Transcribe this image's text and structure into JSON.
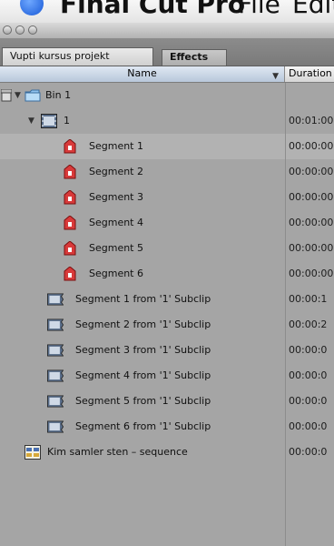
{
  "menubar": {
    "app_name": "Final Cut Pro",
    "menu_file": "File",
    "menu_edit": "Edit"
  },
  "tabs": [
    {
      "label": "Vupti kursus projekt",
      "active": true
    },
    {
      "label": "Effects",
      "active": false
    }
  ],
  "columns": {
    "name": "Name",
    "duration": "Duration"
  },
  "rows": [
    {
      "label": "Bin 1",
      "icon": "folder-icon",
      "duration": ""
    },
    {
      "label": "1",
      "icon": "clip-icon",
      "duration": "00:01:00"
    },
    {
      "label": "Segment 1",
      "icon": "marker-icon",
      "duration": "00:00:00",
      "selected": true
    },
    {
      "label": "Segment 2",
      "icon": "marker-icon",
      "duration": "00:00:00"
    },
    {
      "label": "Segment 3",
      "icon": "marker-icon",
      "duration": "00:00:00"
    },
    {
      "label": "Segment 4",
      "icon": "marker-icon",
      "duration": "00:00:00"
    },
    {
      "label": "Segment 5",
      "icon": "marker-icon",
      "duration": "00:00:00"
    },
    {
      "label": "Segment 6",
      "icon": "marker-icon",
      "duration": "00:00:00"
    },
    {
      "label": "Segment 1 from '1' Subclip",
      "icon": "subclip-icon",
      "duration": "00:00:1"
    },
    {
      "label": "Segment 2 from '1' Subclip",
      "icon": "subclip-icon",
      "duration": "00:00:2"
    },
    {
      "label": "Segment 3 from '1' Subclip",
      "icon": "subclip-icon",
      "duration": "00:00:0"
    },
    {
      "label": "Segment 4 from '1' Subclip",
      "icon": "subclip-icon",
      "duration": "00:00:0"
    },
    {
      "label": "Segment 5 from '1' Subclip",
      "icon": "subclip-icon",
      "duration": "00:00:0"
    },
    {
      "label": "Segment 6 from '1' Subclip",
      "icon": "subclip-icon",
      "duration": "00:00:0"
    },
    {
      "label": "Kim samler sten – sequence",
      "icon": "sequence-icon",
      "duration": "00:00:0"
    }
  ],
  "colors": {
    "selected_row": "#b2b2b2",
    "marker_red": "#d83a3a",
    "folder_blue": "#8fc2ee"
  }
}
